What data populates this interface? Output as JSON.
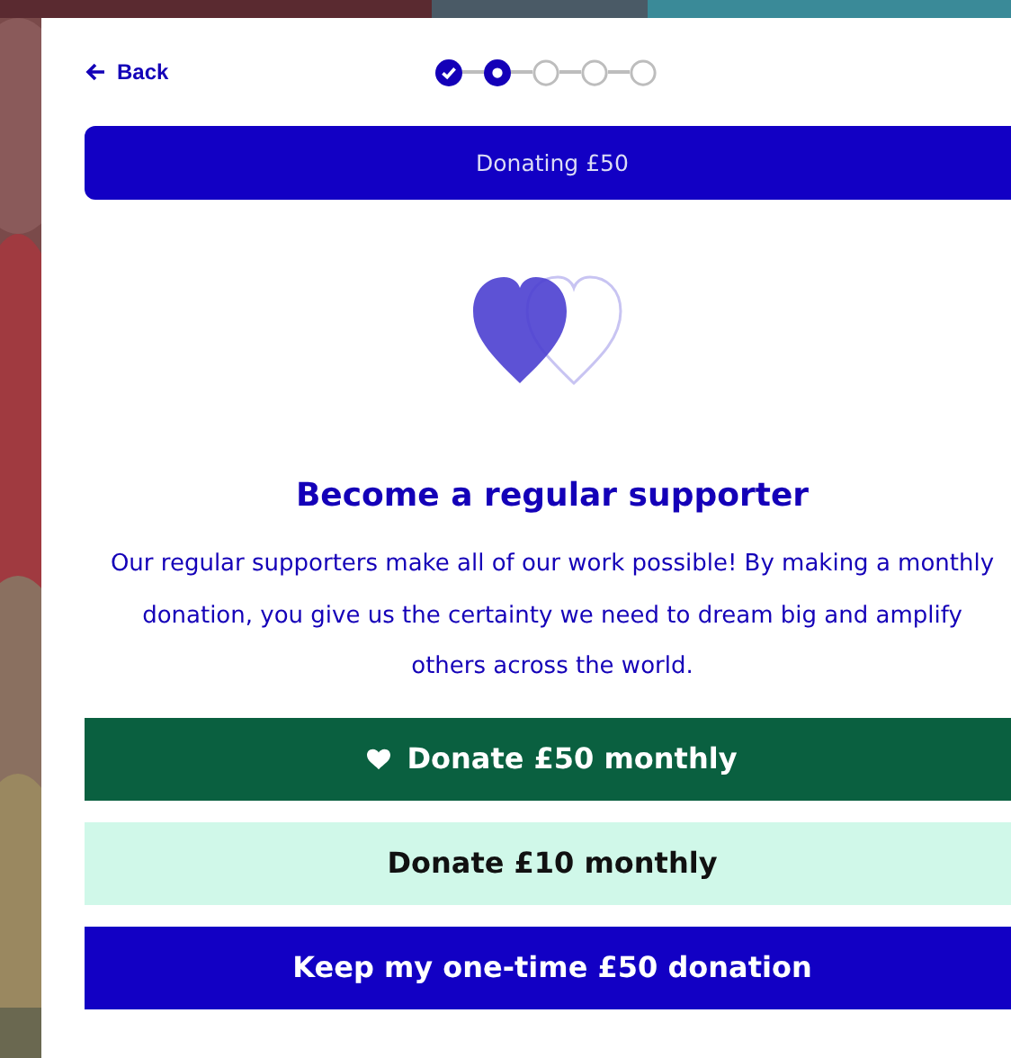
{
  "back_link": {
    "label": "Back"
  },
  "steps": [
    {
      "checked": true,
      "selected": false
    },
    {
      "checked": false,
      "selected": true
    },
    {
      "checked": false,
      "selected": false
    },
    {
      "checked": false,
      "selected": false
    },
    {
      "checked": false,
      "selected": false
    }
  ],
  "banner": {
    "label": "Donating £50"
  },
  "heading": "Become a regular supporter",
  "body": "Our regular supporters make all of our work possible! By making a monthly donation, you give us the certainty we need to dream big and amplify others across the world.",
  "buttons": [
    {
      "kind": "primary",
      "label": "Donate £50 monthly",
      "icon": true
    },
    {
      "kind": "secondary",
      "label": "Donate £10 monthly",
      "icon": false
    },
    {
      "kind": "keep",
      "label": "Keep my one-time £50 donation",
      "icon": false
    }
  ]
}
